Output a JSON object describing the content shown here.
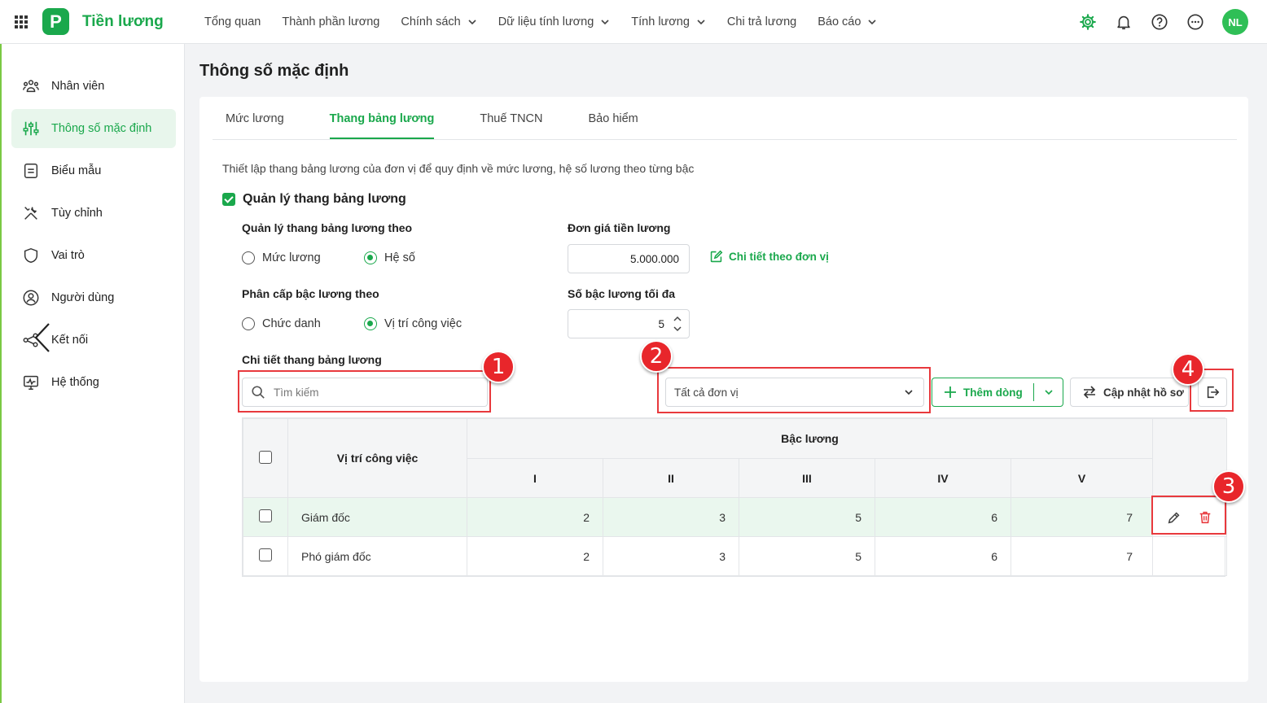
{
  "header": {
    "logo_letter": "P",
    "app_title": "Tiền lương",
    "nav": [
      {
        "label": "Tổng quan",
        "dropdown": false
      },
      {
        "label": "Thành phần lương",
        "dropdown": false
      },
      {
        "label": "Chính sách",
        "dropdown": true
      },
      {
        "label": "Dữ liệu tính lương",
        "dropdown": true
      },
      {
        "label": "Tính lương",
        "dropdown": true
      },
      {
        "label": "Chi trả lương",
        "dropdown": false
      },
      {
        "label": "Báo cáo",
        "dropdown": true
      }
    ],
    "avatar_initials": "NL"
  },
  "sidebar": {
    "items": [
      {
        "label": "Nhân viên",
        "icon": "employees-icon",
        "active": false
      },
      {
        "label": "Thông số mặc định",
        "icon": "sliders-icon",
        "active": true
      },
      {
        "label": "Biểu mẫu",
        "icon": "form-icon",
        "active": false
      },
      {
        "label": "Tùy chỉnh",
        "icon": "tools-icon",
        "active": false
      },
      {
        "label": "Vai trò",
        "icon": "shield-icon",
        "active": false
      },
      {
        "label": "Người dùng",
        "icon": "user-icon",
        "active": false
      },
      {
        "label": "Kết nối",
        "icon": "share-icon",
        "active": false
      },
      {
        "label": "Hệ thống",
        "icon": "monitor-icon",
        "active": false
      }
    ]
  },
  "page": {
    "title": "Thông số mặc định",
    "tabs": [
      {
        "label": "Mức lương",
        "active": false
      },
      {
        "label": "Thang bảng lương",
        "active": true
      },
      {
        "label": "Thuế TNCN",
        "active": false
      },
      {
        "label": "Bảo hiểm",
        "active": false
      }
    ],
    "description": "Thiết lập thang bảng lương của đơn vị để quy định về mức lương, hệ số lương theo từng bậc",
    "manage_checkbox_label": "Quản lý thang bảng lương",
    "manage_by": {
      "label": "Quản lý thang bảng lương theo",
      "options": [
        "Mức lương",
        "Hệ số"
      ],
      "selected": "Hệ số"
    },
    "unit_price": {
      "label": "Đơn giá tiền lương",
      "value": "5.000.000",
      "detail_link": "Chi tiết theo đơn vị"
    },
    "grade_by": {
      "label": "Phân cấp bậc lương theo",
      "options": [
        "Chức danh",
        "Vị trí công việc"
      ],
      "selected": "Vị trí công việc"
    },
    "max_grades": {
      "label": "Số bậc lương tối đa",
      "value": "5"
    },
    "detail_section_label": "Chi tiết thang bảng lương",
    "search_placeholder": "Tìm kiếm",
    "unit_select_value": "Tất cả đơn vị",
    "add_row_label": "Thêm dòng",
    "update_profile_label": "Cập nhật hồ sơ"
  },
  "table": {
    "col_position": "Vị trí công việc",
    "col_group": "Bậc lương",
    "grade_columns": [
      "I",
      "II",
      "III",
      "IV",
      "V"
    ],
    "rows": [
      {
        "position": "Giám đốc",
        "values": [
          "2",
          "3",
          "5",
          "6",
          "7"
        ],
        "highlighted": true
      },
      {
        "position": "Phó giám đốc",
        "values": [
          "2",
          "3",
          "5",
          "6",
          "7"
        ],
        "highlighted": false
      }
    ]
  },
  "annotations": [
    "1",
    "2",
    "3",
    "4"
  ],
  "colors": {
    "brand_green": "#1aa84c",
    "annotation_red": "#e8262b",
    "row_highlight": "#eaf7ee"
  }
}
